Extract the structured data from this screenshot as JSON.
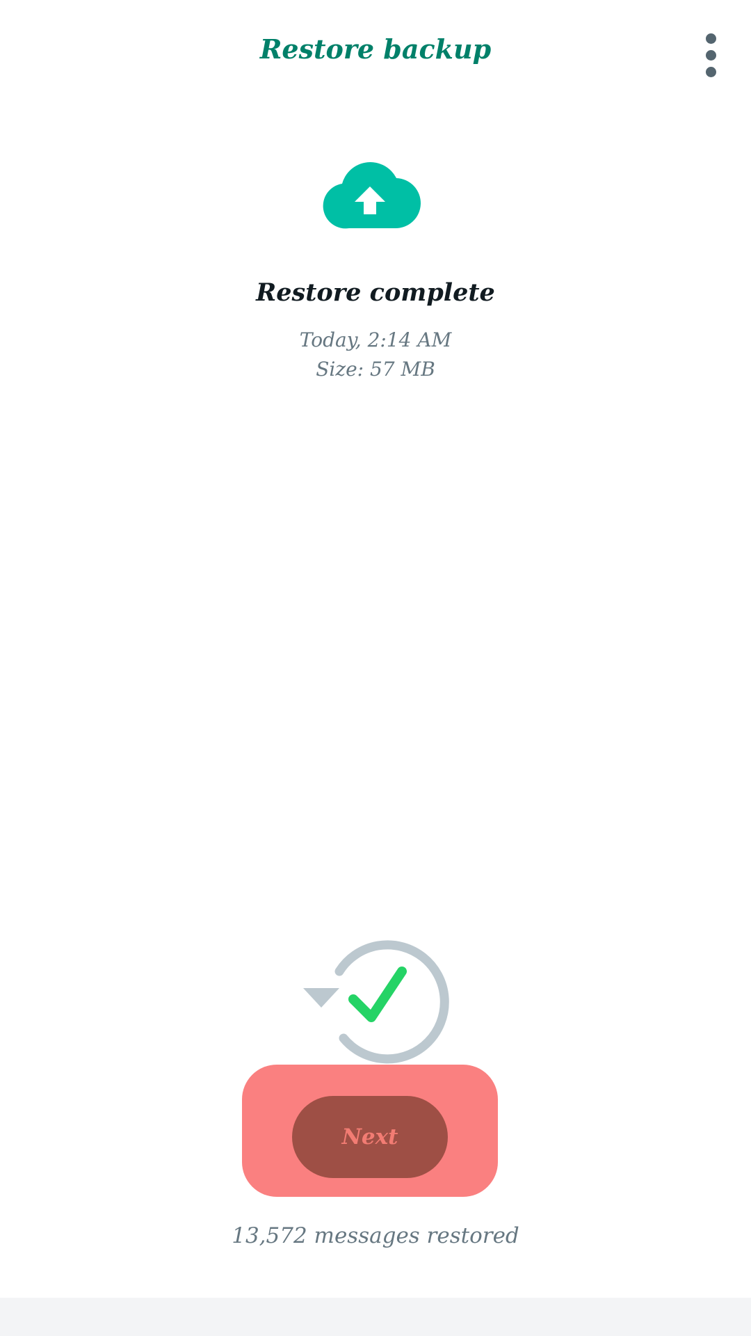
{
  "header": {
    "title": "Restore backup",
    "menu_icon": "more-vert-icon"
  },
  "backup": {
    "icon": "cloud-upload-icon",
    "status": "Restore complete",
    "date": "Today, 2:14 AM",
    "size": "Size: 57 MB"
  },
  "restore_illustration": {
    "icon": "restore-check-icon"
  },
  "actions": {
    "next_label": "Next"
  },
  "footer": {
    "messages_restored": "13,572 messages restored"
  },
  "colors": {
    "accent": "#008069",
    "cloud": "#00bfa5",
    "check": "#25d366",
    "ring": "#bcc8cf",
    "highlight": "#fa8080",
    "button": "#9e4f45",
    "button_text": "#f27c73",
    "secondary_text": "#667781",
    "primary_text": "#111b21"
  }
}
